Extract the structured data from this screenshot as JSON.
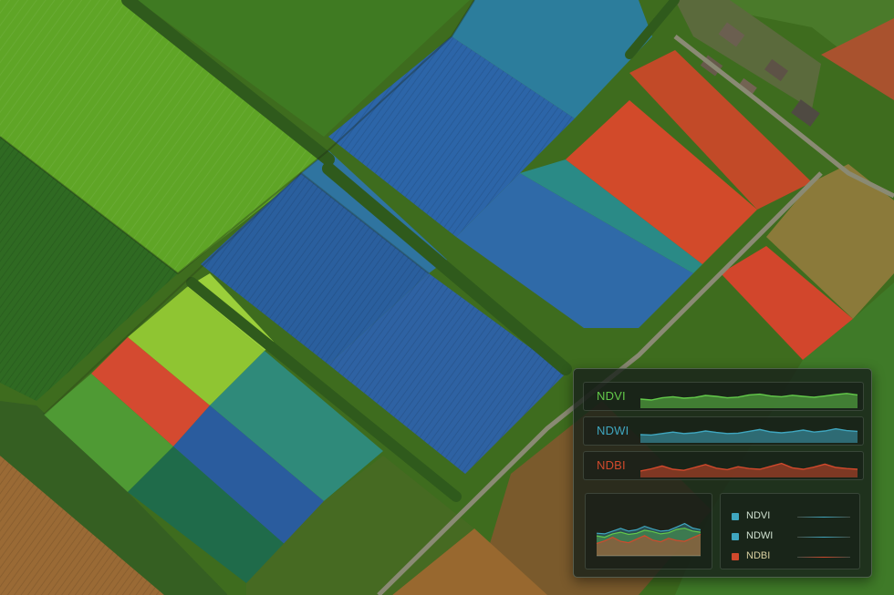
{
  "colors": {
    "ndvi": "#63c94a",
    "ndwi": "#3fa6bf",
    "ndbi": "#d0492c",
    "panel_text": "#cfe0cf"
  },
  "indices": [
    {
      "key": "ndvi",
      "label": "NDVI",
      "color": "#63c94a",
      "profile": [
        0.35,
        0.3,
        0.42,
        0.48,
        0.4,
        0.44,
        0.55,
        0.5,
        0.42,
        0.46,
        0.58,
        0.62,
        0.52,
        0.48,
        0.56,
        0.5,
        0.45,
        0.52,
        0.6,
        0.66,
        0.58
      ]
    },
    {
      "key": "ndwi",
      "label": "NDWI",
      "color": "#3fa6bf",
      "profile": [
        0.3,
        0.28,
        0.36,
        0.44,
        0.36,
        0.4,
        0.5,
        0.42,
        0.36,
        0.38,
        0.48,
        0.58,
        0.45,
        0.4,
        0.46,
        0.55,
        0.44,
        0.5,
        0.62,
        0.52,
        0.48
      ]
    },
    {
      "key": "ndbi",
      "label": "NDBI",
      "color": "#d0492c",
      "profile": [
        0.2,
        0.32,
        0.48,
        0.3,
        0.24,
        0.4,
        0.56,
        0.36,
        0.28,
        0.44,
        0.34,
        0.3,
        0.46,
        0.62,
        0.38,
        0.3,
        0.42,
        0.58,
        0.4,
        0.34,
        0.3
      ]
    }
  ],
  "legend": [
    {
      "label": "NDVI",
      "color": "#3fa6bf"
    },
    {
      "label": "NDWI",
      "color": "#3fa6bf"
    },
    {
      "label": "NDBI",
      "color": "#d0492c"
    }
  ]
}
